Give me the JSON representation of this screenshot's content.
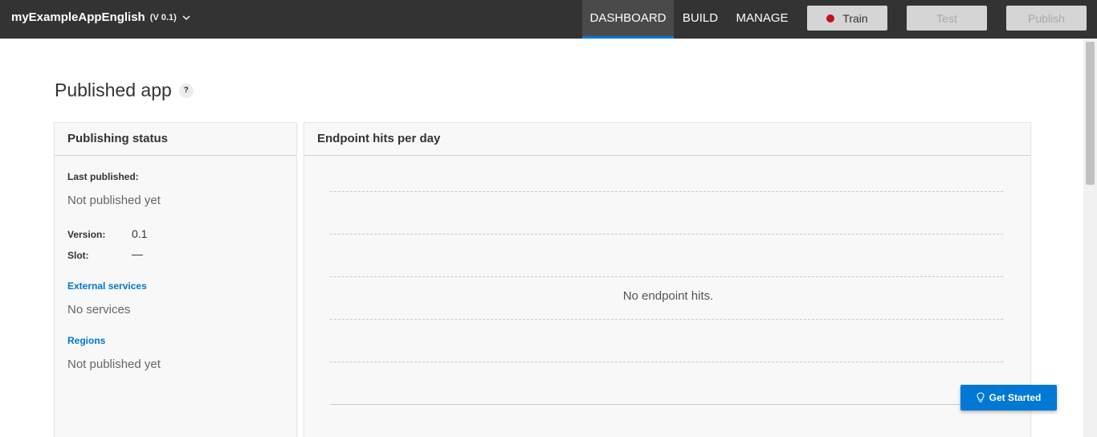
{
  "header": {
    "app_name": "myExampleAppEnglish",
    "app_version": "(V 0.1)",
    "tabs": [
      {
        "label": "DASHBOARD",
        "active": true
      },
      {
        "label": "BUILD",
        "active": false
      },
      {
        "label": "MANAGE",
        "active": false
      }
    ],
    "train_label": "Train",
    "test_label": "Test",
    "publish_label": "Publish"
  },
  "page": {
    "title": "Published app",
    "help_label": "?"
  },
  "publishing_status": {
    "title": "Publishing status",
    "last_published_label": "Last published:",
    "last_published_value": "Not published yet",
    "version_label": "Version:",
    "version_value": "0.1",
    "slot_label": "Slot:",
    "slot_value": "—",
    "external_services_label": "External services",
    "external_services_value": "No services",
    "regions_label": "Regions",
    "regions_value": "Not published yet"
  },
  "endpoint_hits": {
    "title": "Endpoint hits per day",
    "empty_message": "No endpoint hits."
  },
  "get_started": {
    "label": "Get Started"
  },
  "colors": {
    "topbar": "#333333",
    "accent": "#0078d4",
    "train_indicator": "#c50f1f"
  }
}
